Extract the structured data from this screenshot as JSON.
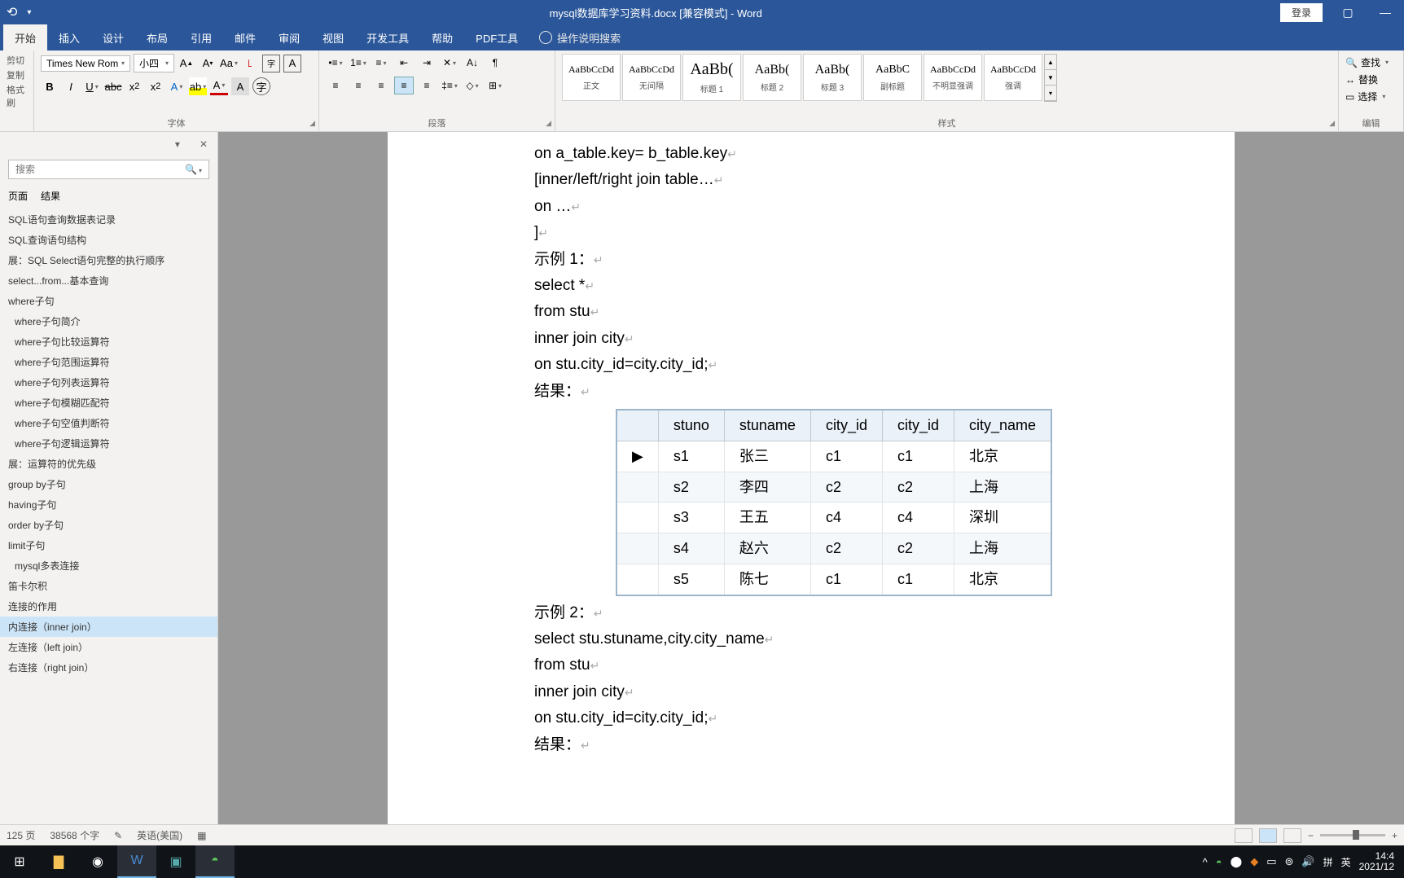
{
  "titlebar": {
    "doc_title": "mysql数据库学习资料.docx [兼容模式] - Word",
    "login": "登录"
  },
  "ribbon_tabs": [
    "开始",
    "插入",
    "设计",
    "布局",
    "引用",
    "邮件",
    "审阅",
    "视图",
    "开发工具",
    "帮助",
    "PDF工具"
  ],
  "tell_me": "操作说明搜索",
  "clipboard": {
    "cut": "剪切",
    "copy": "复制",
    "painter": "格式刷"
  },
  "font": {
    "name": "Times New Rom",
    "size": "小四",
    "group_label": "字体"
  },
  "paragraph": {
    "group_label": "段落"
  },
  "styles": {
    "group_label": "样式",
    "items": [
      {
        "preview": "AaBbCcDd",
        "name": "正文",
        "size": "12px"
      },
      {
        "preview": "AaBbCcDd",
        "name": "无间隔",
        "size": "12px"
      },
      {
        "preview": "AaBb(",
        "name": "标题 1",
        "size": "20px"
      },
      {
        "preview": "AaBb(",
        "name": "标题 2",
        "size": "16px"
      },
      {
        "preview": "AaBb(",
        "name": "标题 3",
        "size": "16px"
      },
      {
        "preview": "AaBbC",
        "name": "副标题",
        "size": "14px"
      },
      {
        "preview": "AaBbCcDd",
        "name": "不明显强调",
        "size": "12px"
      },
      {
        "preview": "AaBbCcDd",
        "name": "强调",
        "size": "12px"
      }
    ]
  },
  "editing": {
    "find": "查找",
    "replace": "替换",
    "select": "选择",
    "group_label": "编辑"
  },
  "nav": {
    "search_placeholder": "搜索",
    "tabs": [
      "页面",
      "结果"
    ],
    "items": [
      {
        "text": "SQL语句查询数据表记录",
        "indent": 0
      },
      {
        "text": "SQL查询语句结构",
        "indent": 0
      },
      {
        "text": "展：SQL Select语句完整的执行顺序",
        "indent": 0
      },
      {
        "text": "select...from...基本查询",
        "indent": 0
      },
      {
        "text": "where子句",
        "indent": 0
      },
      {
        "text": "where子句简介",
        "indent": 1
      },
      {
        "text": "where子句比较运算符",
        "indent": 1
      },
      {
        "text": "where子句范围运算符",
        "indent": 1
      },
      {
        "text": "where子句列表运算符",
        "indent": 1
      },
      {
        "text": "where子句模糊匹配符",
        "indent": 1
      },
      {
        "text": "where子句空值判断符",
        "indent": 1
      },
      {
        "text": "where子句逻辑运算符",
        "indent": 1
      },
      {
        "text": "展：运算符的优先级",
        "indent": 0
      },
      {
        "text": "group by子句",
        "indent": 0
      },
      {
        "text": "having子句",
        "indent": 0
      },
      {
        "text": "order by子句",
        "indent": 0
      },
      {
        "text": "limit子句",
        "indent": 0
      },
      {
        "text": "mysql多表连接",
        "indent": 1
      },
      {
        "text": "笛卡尔积",
        "indent": 0
      },
      {
        "text": "连接的作用",
        "indent": 0
      },
      {
        "text": "内连接（inner join）",
        "indent": 0,
        "selected": true
      },
      {
        "text": "左连接（left join）",
        "indent": 0
      },
      {
        "text": "右连接（right join）",
        "indent": 0
      }
    ]
  },
  "doc": {
    "lines_before": [
      "on a_table.key= b_table.key",
      "[inner/left/right join table…",
      "on …",
      "]",
      "示例 1：",
      "select *",
      "from stu",
      "inner join city",
      "on stu.city_id=city.city_id;",
      "结果："
    ],
    "table": {
      "headers": [
        "stuno",
        "stuname",
        "city_id",
        "city_id",
        "city_name"
      ],
      "rows": [
        [
          "s1",
          "张三",
          "c1",
          "c1",
          "北京"
        ],
        [
          "s2",
          "李四",
          "c2",
          "c2",
          "上海"
        ],
        [
          "s3",
          "王五",
          "c4",
          "c4",
          "深圳"
        ],
        [
          "s4",
          "赵六",
          "c2",
          "c2",
          "上海"
        ],
        [
          "s5",
          "陈七",
          "c1",
          "c1",
          "北京"
        ]
      ]
    },
    "lines_after": [
      "示例 2：",
      "select stu.stuname,city.city_name",
      "from stu",
      "inner join city",
      "on stu.city_id=city.city_id;",
      "结果："
    ]
  },
  "status": {
    "page": "125 页",
    "words": "38568 个字",
    "lang": "英语(美国)"
  },
  "tray": {
    "ime1": "拼",
    "ime2": "英",
    "time": "14:4",
    "date": "2021/12"
  }
}
